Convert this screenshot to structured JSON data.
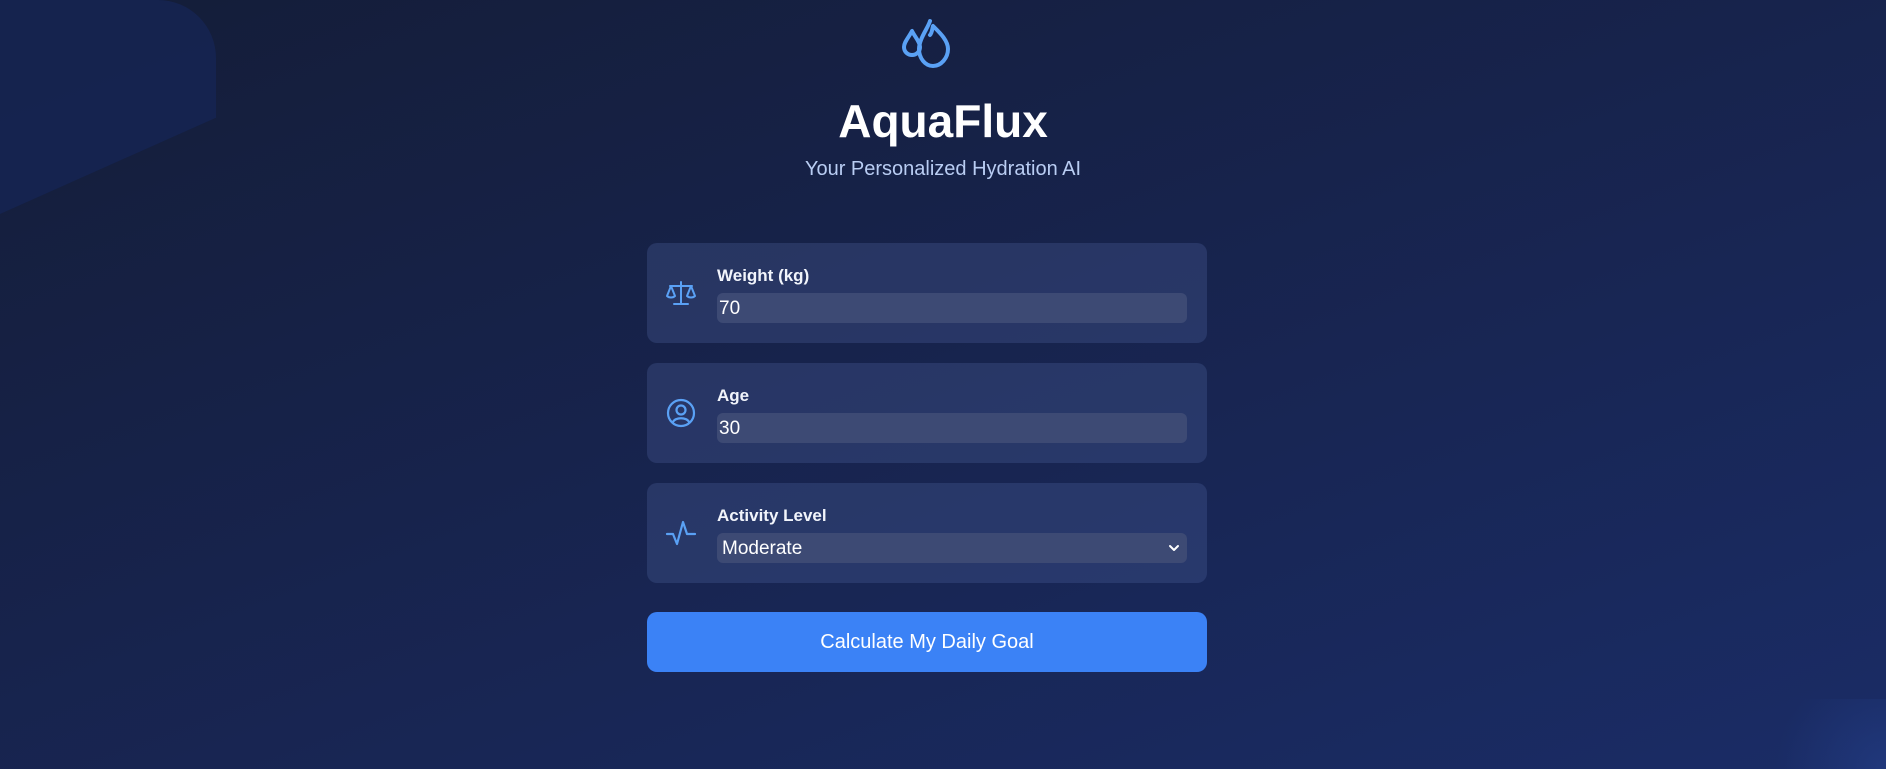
{
  "app": {
    "title": "AquaFlux",
    "subtitle": "Your Personalized Hydration AI",
    "logo_icon": "water-drops-icon"
  },
  "colors": {
    "accent": "#3b82f6",
    "icon": "#5aa1f5",
    "card": "#2a3665",
    "field": "#3d4a74"
  },
  "form": {
    "weight": {
      "label": "Weight (kg)",
      "value": "70",
      "icon": "scale-icon"
    },
    "age": {
      "label": "Age",
      "value": "30",
      "icon": "user-circle-icon"
    },
    "activity": {
      "label": "Activity Level",
      "value": "Moderate",
      "icon": "activity-pulse-icon"
    }
  },
  "actions": {
    "calculate_label": "Calculate My Daily Goal"
  }
}
